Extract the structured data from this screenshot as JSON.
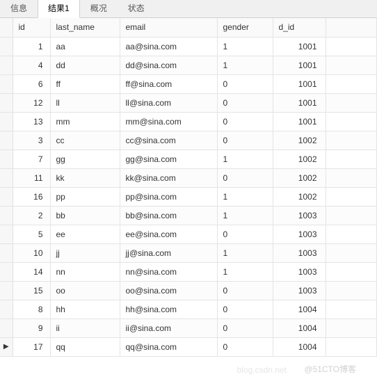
{
  "tabs": [
    {
      "label": "信息",
      "active": false
    },
    {
      "label": "结果1",
      "active": true
    },
    {
      "label": "概况",
      "active": false
    },
    {
      "label": "状态",
      "active": false
    }
  ],
  "columns": {
    "id": "id",
    "last_name": "last_name",
    "email": "email",
    "gender": "gender",
    "d_id": "d_id"
  },
  "rows": [
    {
      "id": "1",
      "last_name": "aa",
      "email": "aa@sina.com",
      "gender": "1",
      "d_id": "1001",
      "current": false
    },
    {
      "id": "4",
      "last_name": "dd",
      "email": "dd@sina.com",
      "gender": "1",
      "d_id": "1001",
      "current": false
    },
    {
      "id": "6",
      "last_name": "ff",
      "email": "ff@sina.com",
      "gender": "0",
      "d_id": "1001",
      "current": false
    },
    {
      "id": "12",
      "last_name": "ll",
      "email": "ll@sina.com",
      "gender": "0",
      "d_id": "1001",
      "current": false
    },
    {
      "id": "13",
      "last_name": "mm",
      "email": "mm@sina.com",
      "gender": "0",
      "d_id": "1001",
      "current": false
    },
    {
      "id": "3",
      "last_name": "cc",
      "email": "cc@sina.com",
      "gender": "0",
      "d_id": "1002",
      "current": false
    },
    {
      "id": "7",
      "last_name": "gg",
      "email": "gg@sina.com",
      "gender": "1",
      "d_id": "1002",
      "current": false
    },
    {
      "id": "11",
      "last_name": "kk",
      "email": "kk@sina.com",
      "gender": "0",
      "d_id": "1002",
      "current": false
    },
    {
      "id": "16",
      "last_name": "pp",
      "email": "pp@sina.com",
      "gender": "1",
      "d_id": "1002",
      "current": false
    },
    {
      "id": "2",
      "last_name": "bb",
      "email": "bb@sina.com",
      "gender": "1",
      "d_id": "1003",
      "current": false
    },
    {
      "id": "5",
      "last_name": "ee",
      "email": "ee@sina.com",
      "gender": "0",
      "d_id": "1003",
      "current": false
    },
    {
      "id": "10",
      "last_name": "jj",
      "email": "jj@sina.com",
      "gender": "1",
      "d_id": "1003",
      "current": false
    },
    {
      "id": "14",
      "last_name": "nn",
      "email": "nn@sina.com",
      "gender": "1",
      "d_id": "1003",
      "current": false
    },
    {
      "id": "15",
      "last_name": "oo",
      "email": "oo@sina.com",
      "gender": "0",
      "d_id": "1003",
      "current": false
    },
    {
      "id": "8",
      "last_name": "hh",
      "email": "hh@sina.com",
      "gender": "0",
      "d_id": "1004",
      "current": false
    },
    {
      "id": "9",
      "last_name": "ii",
      "email": "ii@sina.com",
      "gender": "0",
      "d_id": "1004",
      "current": false
    },
    {
      "id": "17",
      "last_name": "qq",
      "email": "qq@sina.com",
      "gender": "0",
      "d_id": "1004",
      "current": true
    }
  ],
  "row_indicator_glyph": "▶",
  "watermarks": {
    "a": "blog.csdn.net",
    "b": "@51CTO博客"
  }
}
